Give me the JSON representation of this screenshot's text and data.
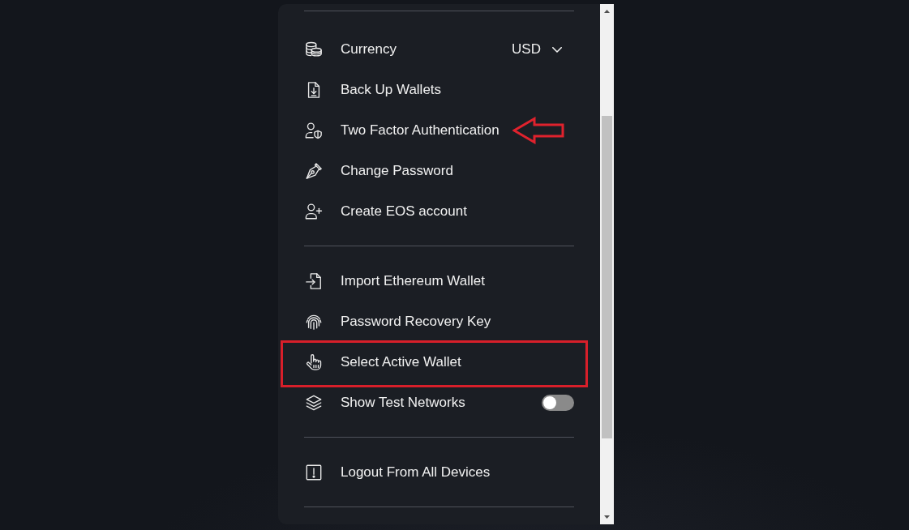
{
  "settings_menu": {
    "sections": [
      {
        "items": [
          {
            "kind": "select",
            "label": "Currency",
            "value": "USD",
            "arrow_marked": false,
            "framed": false
          },
          {
            "kind": "link",
            "label": "Back Up Wallets",
            "arrow_marked": false,
            "framed": false
          },
          {
            "kind": "link",
            "label": "Two Factor Authentication",
            "arrow_marked": true,
            "framed": false
          },
          {
            "kind": "link",
            "label": "Change Password",
            "arrow_marked": false,
            "framed": false
          },
          {
            "kind": "link",
            "label": "Create EOS account",
            "arrow_marked": false,
            "framed": false
          }
        ]
      },
      {
        "items": [
          {
            "kind": "link",
            "label": "Import Ethereum Wallet",
            "arrow_marked": false,
            "framed": false
          },
          {
            "kind": "link",
            "label": "Password Recovery Key",
            "arrow_marked": false,
            "framed": false
          },
          {
            "kind": "link",
            "label": "Select Active Wallet",
            "arrow_marked": false,
            "framed": true
          },
          {
            "kind": "toggle",
            "label": "Show Test Networks",
            "on": false,
            "arrow_marked": false,
            "framed": false
          }
        ]
      },
      {
        "items": [
          {
            "kind": "link",
            "label": "Logout From All Devices",
            "arrow_marked": false,
            "framed": false
          }
        ]
      }
    ]
  }
}
